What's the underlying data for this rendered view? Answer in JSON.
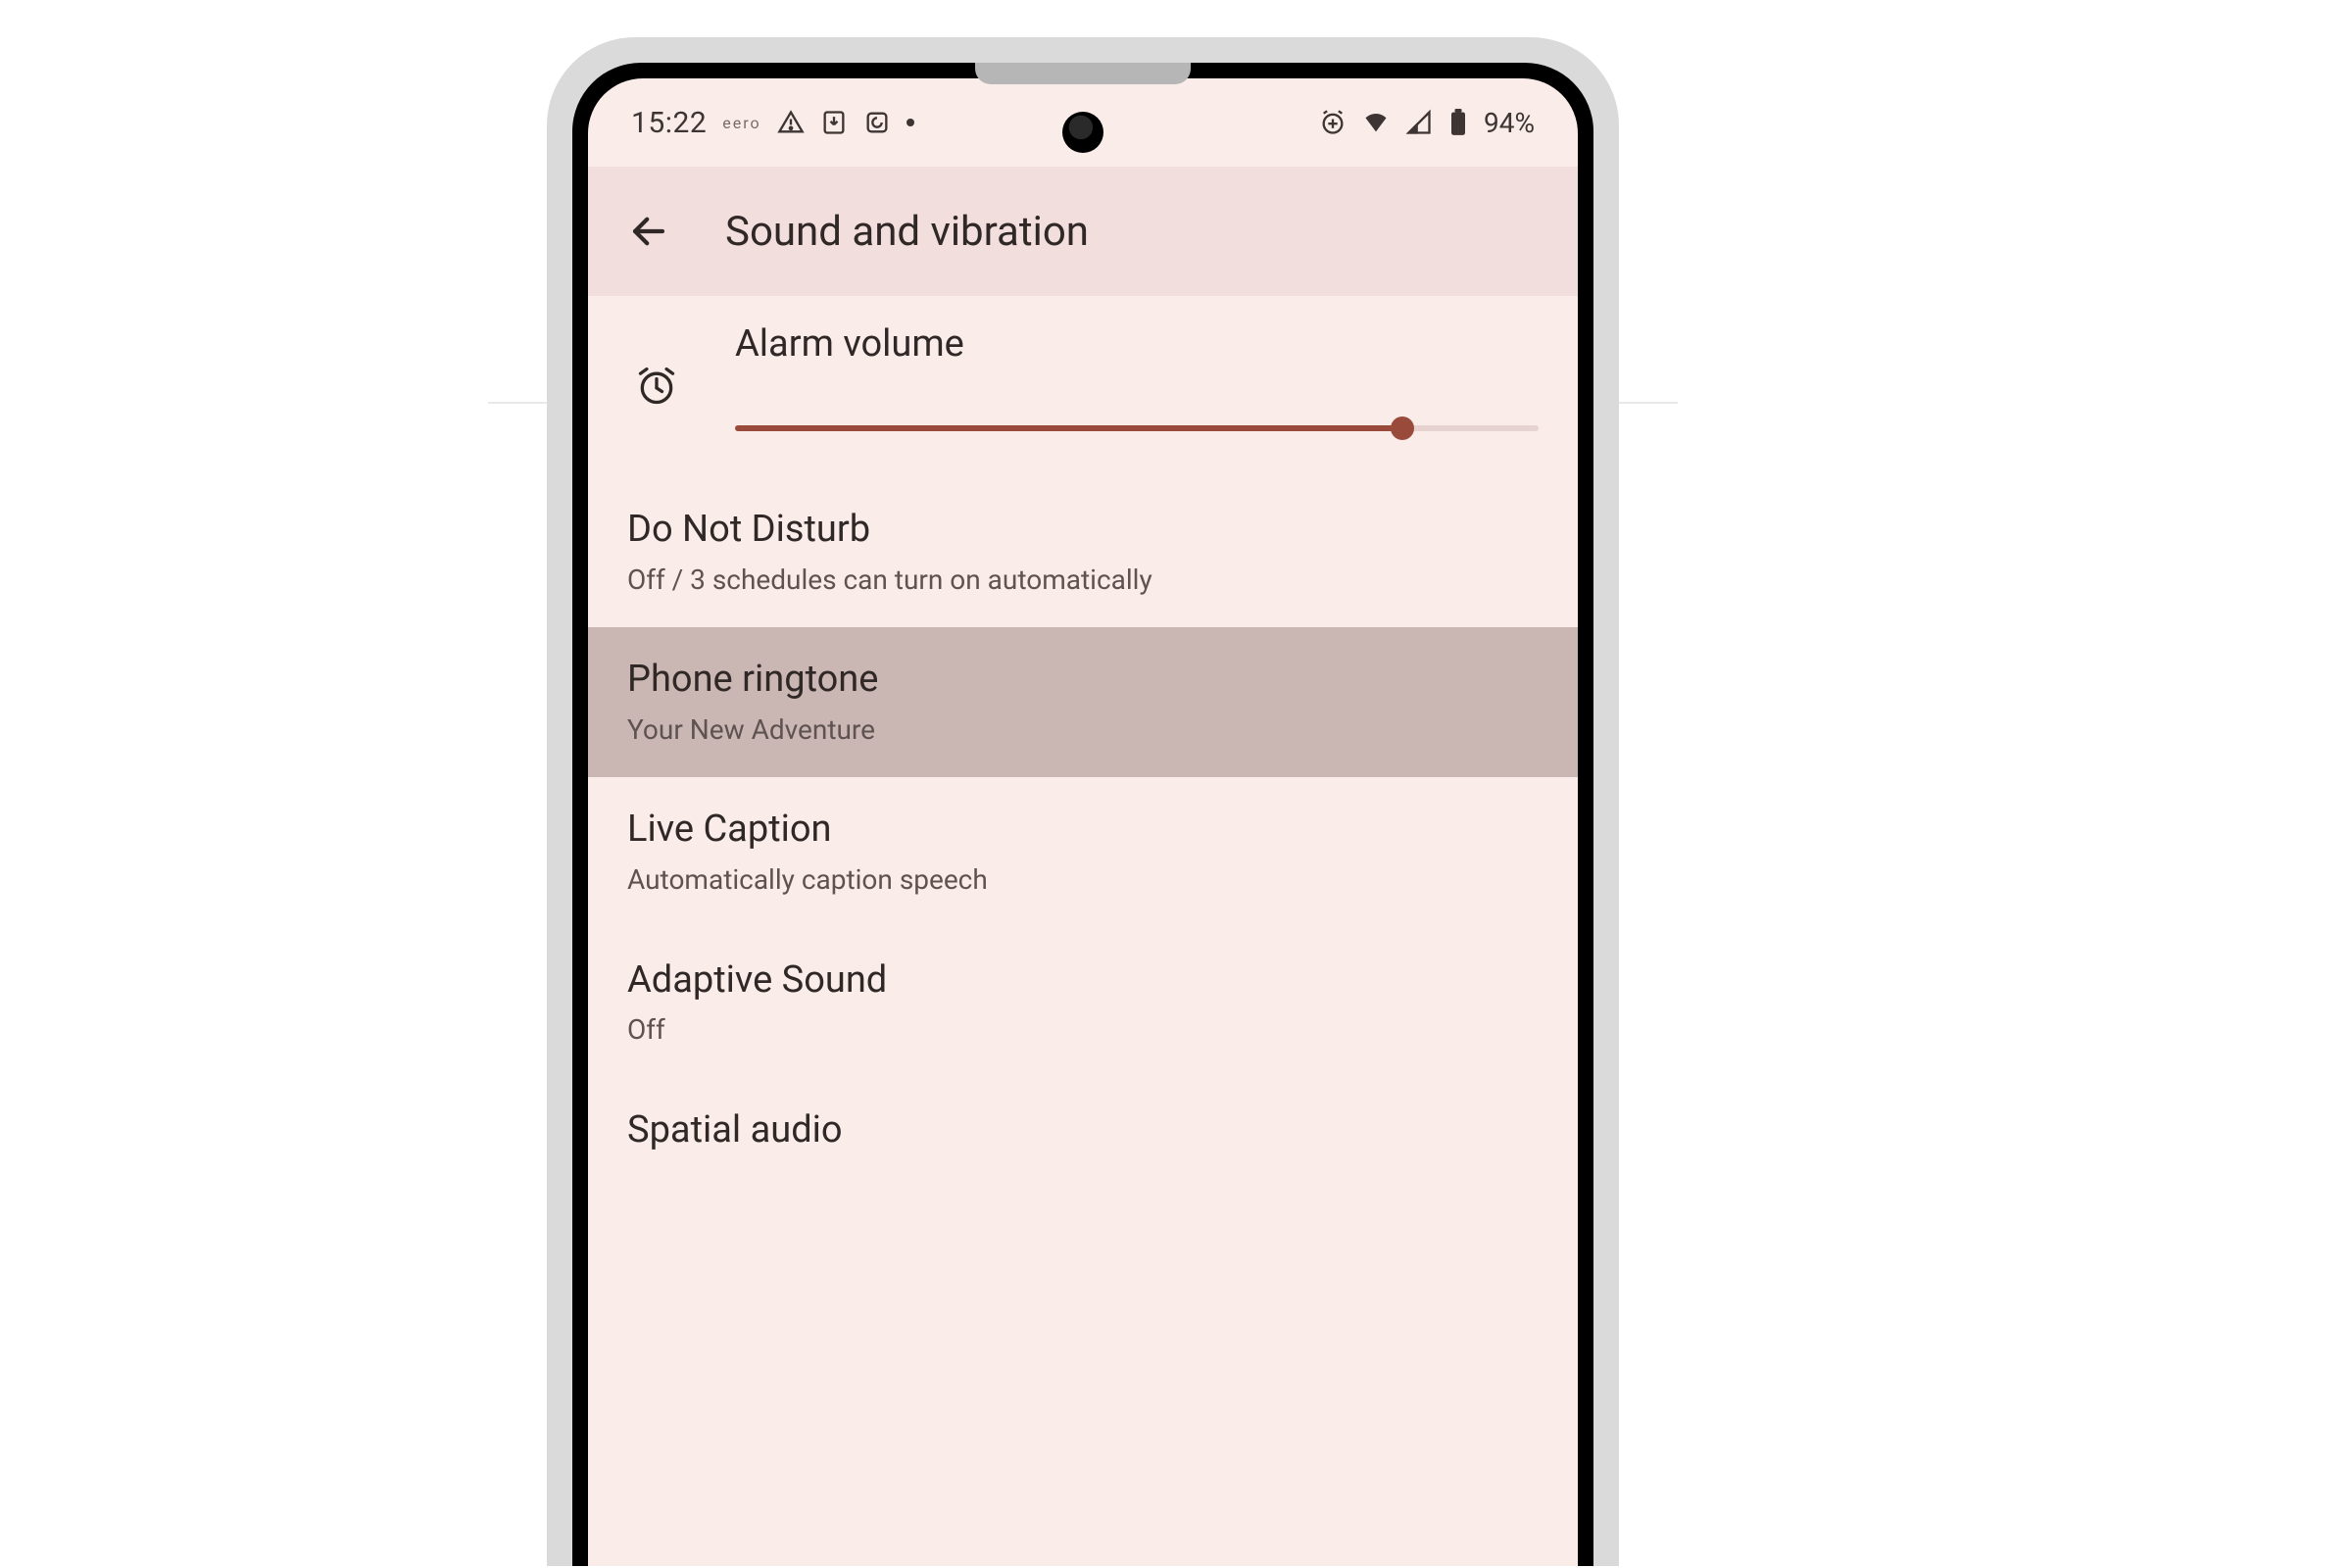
{
  "statusbar": {
    "time": "15:22",
    "carrier": "eero",
    "battery_pct": "94%"
  },
  "appbar": {
    "title": "Sound and vibration"
  },
  "alarm": {
    "label": "Alarm volume",
    "value_pct": 83
  },
  "rows": [
    {
      "title": "Do Not Disturb",
      "subtitle": "Off / 3 schedules can turn on automatically",
      "pressed": false
    },
    {
      "title": "Phone ringtone",
      "subtitle": "Your New Adventure",
      "pressed": true
    },
    {
      "title": "Live Caption",
      "subtitle": "Automatically caption speech",
      "pressed": false
    },
    {
      "title": "Adaptive Sound",
      "subtitle": "Off",
      "pressed": false
    },
    {
      "title": "Spatial audio",
      "subtitle": "",
      "pressed": false
    }
  ]
}
